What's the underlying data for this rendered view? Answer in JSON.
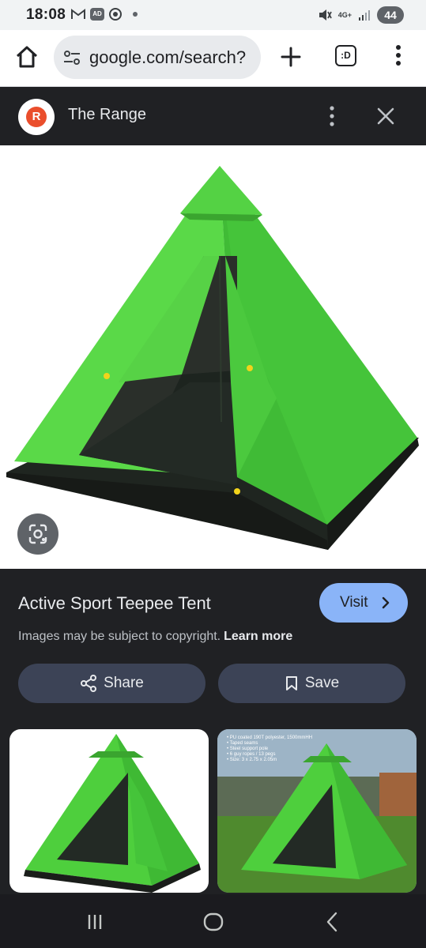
{
  "status_bar": {
    "time": "18:08",
    "left_icons": [
      "gmail-icon",
      "ad-app-icon",
      "chrome-icon",
      "dot"
    ],
    "ad_badge": "AD",
    "network": "4G+",
    "battery": "44"
  },
  "browser": {
    "url": "google.com/search?",
    "tabs_label": ":D"
  },
  "site": {
    "name": "The Range",
    "logo_letter": "R",
    "brand_color": "#ea4e2c"
  },
  "result": {
    "title": "Active Sport Teepee Tent",
    "visit_label": "Visit",
    "copyright_text": "Images may be subject to copyright.",
    "learn_more": "Learn more",
    "share_label": "Share",
    "save_label": "Save"
  },
  "thumbnails": [
    {
      "alt": "green teepee tent"
    },
    {
      "alt": "green teepee tent on grass",
      "lines": [
        "• PU coated 190T polyester, 1500mmHH",
        "• Taped seams",
        "• Steel support pole",
        "• 6 guy ropes / 13 pegs",
        "• Size: 3 x 2.75 x 2.05m"
      ]
    }
  ],
  "colors": {
    "accent": "#8ab4f8",
    "panel_bg": "#202124",
    "button_bg": "#3c4356",
    "tent_green": "#4fd13e"
  }
}
